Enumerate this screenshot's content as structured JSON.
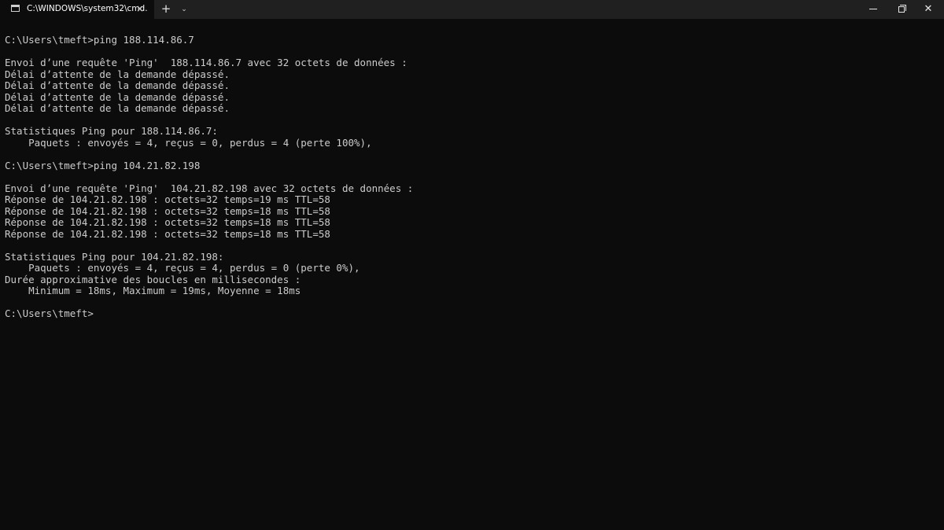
{
  "tab": {
    "title": "C:\\WINDOWS\\system32\\cmd.",
    "close_icon": "×",
    "new_tab_icon": "+",
    "dropdown_icon": "⌄"
  },
  "window_controls": {
    "close_glyph": "✕"
  },
  "colors": {
    "background": "#0c0c0c",
    "titlebar": "#202020",
    "text": "#cccccc"
  },
  "console": {
    "lines": [
      "C:\\Users\\tmeft>ping 188.114.86.7",
      "",
      "Envoi d’une requête 'Ping'  188.114.86.7 avec 32 octets de données :",
      "Délai d’attente de la demande dépassé.",
      "Délai d’attente de la demande dépassé.",
      "Délai d’attente de la demande dépassé.",
      "Délai d’attente de la demande dépassé.",
      "",
      "Statistiques Ping pour 188.114.86.7:",
      "    Paquets : envoyés = 4, reçus = 0, perdus = 4 (perte 100%),",
      "",
      "C:\\Users\\tmeft>ping 104.21.82.198",
      "",
      "Envoi d’une requête 'Ping'  104.21.82.198 avec 32 octets de données :",
      "Réponse de 104.21.82.198 : octets=32 temps=19 ms TTL=58",
      "Réponse de 104.21.82.198 : octets=32 temps=18 ms TTL=58",
      "Réponse de 104.21.82.198 : octets=32 temps=18 ms TTL=58",
      "Réponse de 104.21.82.198 : octets=32 temps=18 ms TTL=58",
      "",
      "Statistiques Ping pour 104.21.82.198:",
      "    Paquets : envoyés = 4, reçus = 4, perdus = 0 (perte 0%),",
      "Durée approximative des boucles en millisecondes :",
      "    Minimum = 18ms, Maximum = 19ms, Moyenne = 18ms",
      "",
      "C:\\Users\\tmeft>"
    ]
  }
}
